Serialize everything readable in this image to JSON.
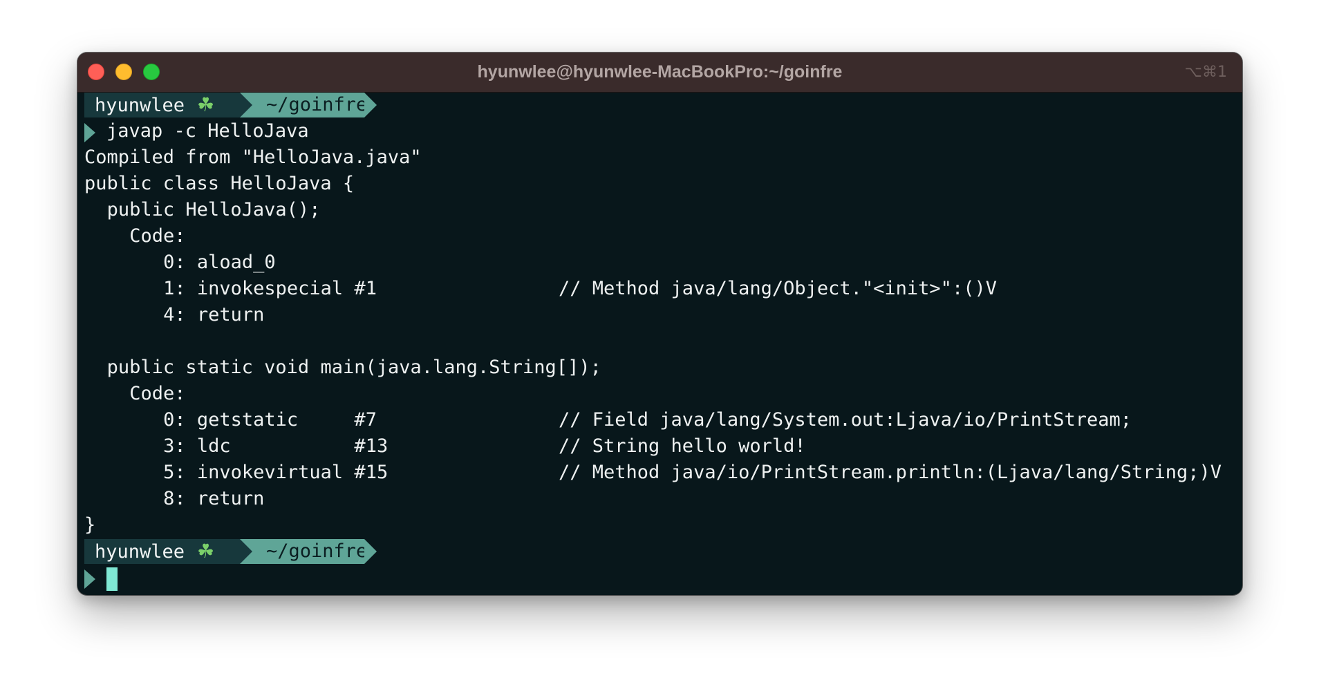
{
  "window": {
    "title": "hyunwlee@hyunwlee-MacBookPro:~/goinfre",
    "shortcut": "⌥⌘1"
  },
  "prompt": {
    "user": "hyunwlee",
    "clover_icon": "☘",
    "dir": "~/goinfre"
  },
  "command": "javap -c HelloJava",
  "output": [
    {
      "indent": "",
      "text": "Compiled from \"HelloJava.java\"",
      "comment": ""
    },
    {
      "indent": "",
      "text": "public class HelloJava {",
      "comment": ""
    },
    {
      "indent": "  ",
      "text": "public HelloJava();",
      "comment": ""
    },
    {
      "indent": "    ",
      "text": "Code:",
      "comment": ""
    },
    {
      "indent": "       ",
      "text": "0: aload_0",
      "comment": ""
    },
    {
      "indent": "       ",
      "text": "1: invokespecial #1",
      "comment": "// Method java/lang/Object.\"<init>\":()V"
    },
    {
      "indent": "       ",
      "text": "4: return",
      "comment": ""
    },
    {
      "indent": "",
      "text": "",
      "comment": ""
    },
    {
      "indent": "  ",
      "text": "public static void main(java.lang.String[]);",
      "comment": ""
    },
    {
      "indent": "    ",
      "text": "Code:",
      "comment": ""
    },
    {
      "indent": "       ",
      "text": "0: getstatic     #7",
      "comment": "// Field java/lang/System.out:Ljava/io/PrintStream;"
    },
    {
      "indent": "       ",
      "text": "3: ldc           #13",
      "comment": "// String hello world!"
    },
    {
      "indent": "       ",
      "text": "5: invokevirtual #15",
      "comment": "// Method java/io/PrintStream.println:(Ljava/lang/String;)V"
    },
    {
      "indent": "       ",
      "text": "8: return",
      "comment": ""
    },
    {
      "indent": "",
      "text": "}",
      "comment": ""
    }
  ],
  "colors": {
    "terminal_bg": "#08171b",
    "titlebar_bg": "#3a2b2b",
    "prompt_user_bg": "#17383c",
    "prompt_dir_bg": "#5fa597",
    "cursor": "#7fe8d4"
  }
}
